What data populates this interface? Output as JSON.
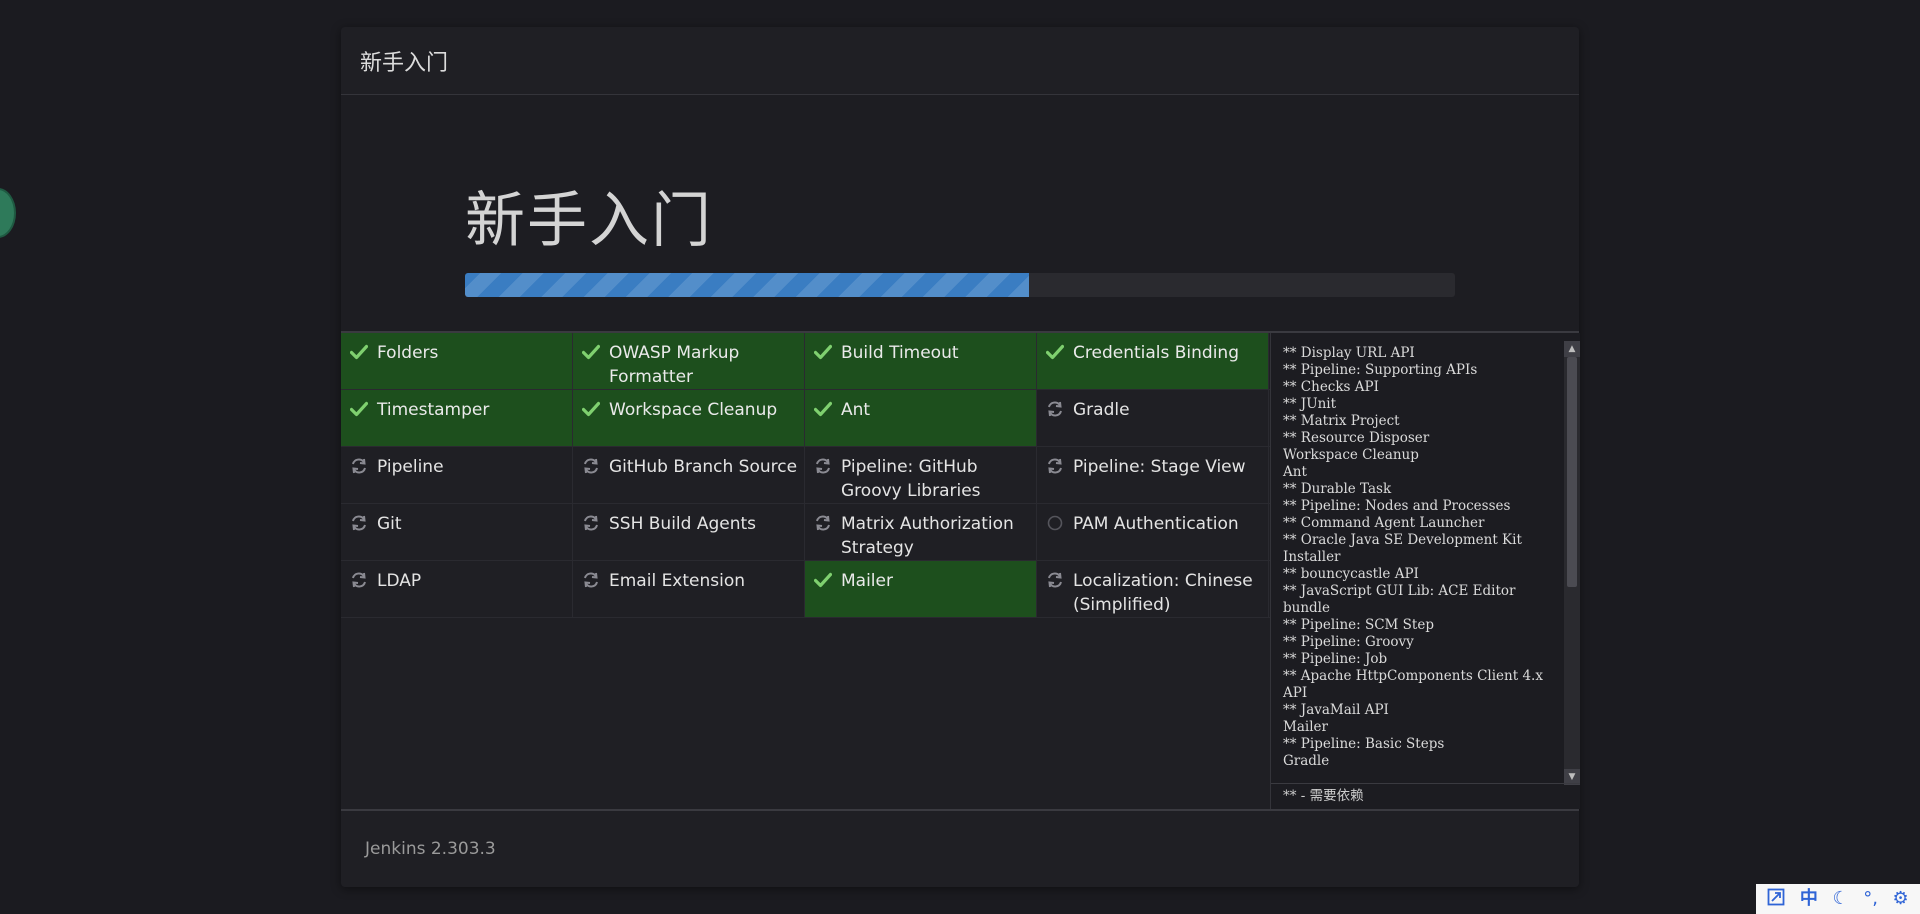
{
  "dialog": {
    "header_title": "新手入门",
    "hero_title": "新手入门",
    "progress": 0.57,
    "footer_version": "Jenkins 2.303.3"
  },
  "plugins": [
    [
      {
        "label": "Folders",
        "status": "success"
      },
      {
        "label": "OWASP Markup Formatter",
        "status": "success"
      },
      {
        "label": "Build Timeout",
        "status": "success"
      },
      {
        "label": "Credentials Binding",
        "status": "success"
      }
    ],
    [
      {
        "label": "Timestamper",
        "status": "success"
      },
      {
        "label": "Workspace Cleanup",
        "status": "success"
      },
      {
        "label": "Ant",
        "status": "success"
      },
      {
        "label": "Gradle",
        "status": "installing"
      }
    ],
    [
      {
        "label": "Pipeline",
        "status": "installing"
      },
      {
        "label": "GitHub Branch Source",
        "status": "installing"
      },
      {
        "label": "Pipeline: GitHub Groovy Libraries",
        "status": "installing"
      },
      {
        "label": "Pipeline: Stage View",
        "status": "installing"
      }
    ],
    [
      {
        "label": "Git",
        "status": "installing"
      },
      {
        "label": "SSH Build Agents",
        "status": "installing"
      },
      {
        "label": "Matrix Authorization Strategy",
        "status": "installing"
      },
      {
        "label": "PAM Authentication",
        "status": "pending"
      }
    ],
    [
      {
        "label": "LDAP",
        "status": "installing"
      },
      {
        "label": "Email Extension",
        "status": "installing"
      },
      {
        "label": "Mailer",
        "status": "success"
      },
      {
        "label": "Localization: Chinese (Simplified)",
        "status": "installing"
      }
    ]
  ],
  "log": {
    "lines": [
      "** Display URL API",
      "** Pipeline: Supporting APIs",
      "** Checks API",
      "** JUnit",
      "** Matrix Project",
      "** Resource Disposer",
      "Workspace Cleanup",
      "Ant",
      "** Durable Task",
      "** Pipeline: Nodes and Processes",
      "** Command Agent Launcher",
      "** Oracle Java SE Development Kit Installer",
      "** bouncycastle API",
      "** JavaScript GUI Lib: ACE Editor bundle",
      "** Pipeline: SCM Step",
      "** Pipeline: Groovy",
      "** Pipeline: Job",
      "** Apache HttpComponents Client 4.x API",
      "** JavaMail API",
      "Mailer",
      "** Pipeline: Basic Steps",
      "Gradle"
    ],
    "footer": "** - 需要依赖"
  },
  "tray": {
    "icons": [
      "expand-icon",
      "ime-chinese-icon",
      "moon-icon",
      "punctuation-icon",
      "gear-icon"
    ],
    "ime_label": "中"
  },
  "colors": {
    "success_bg": "#1d4f1d",
    "check": "#7fd06f",
    "progress": "#3a7dc2"
  }
}
